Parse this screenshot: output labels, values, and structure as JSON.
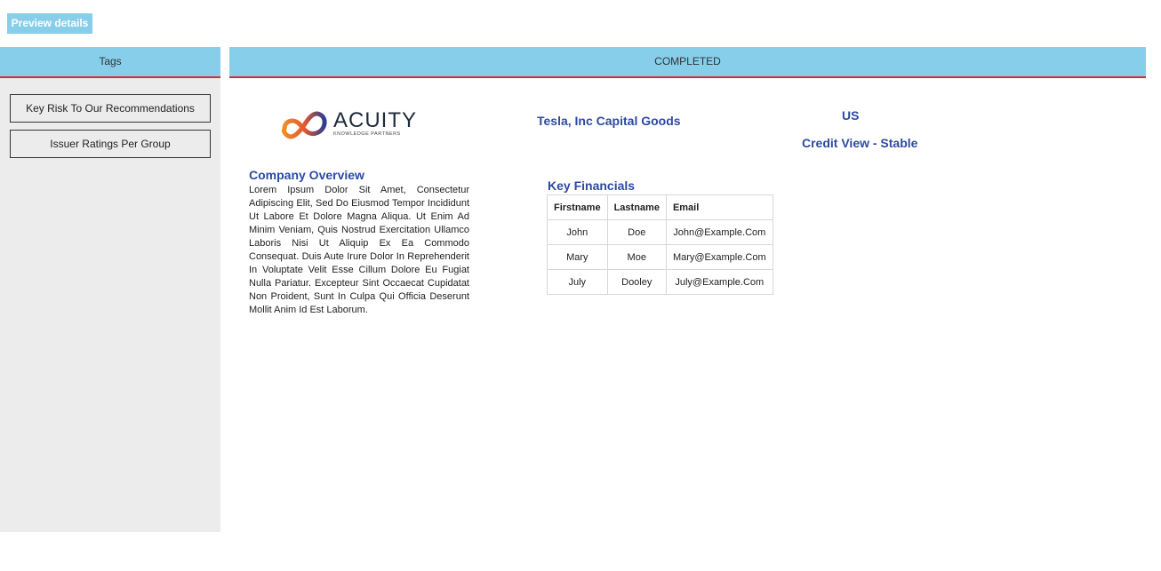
{
  "toolbar": {
    "preview_label": "Preview details"
  },
  "sidebar": {
    "header": "Tags",
    "items": [
      {
        "label": "Key Risk To Our Recommendations"
      },
      {
        "label": "Issuer Ratings Per Group"
      }
    ]
  },
  "main": {
    "status": "COMPLETED",
    "logo": {
      "name": "ACUITY",
      "tagline": "KNOWLEDGE PARTNERS"
    },
    "company_name": "Tesla, Inc Capital Goods",
    "country": "US",
    "credit_view": "Credit View - Stable",
    "overview": {
      "title": "Company Overview",
      "text": "Lorem Ipsum Dolor Sit Amet, Consectetur Adipiscing Elit, Sed Do Eiusmod Tempor Incididunt Ut Labore Et Dolore Magna Aliqua. Ut Enim Ad Minim Veniam, Quis Nostrud Exercitation Ullamco Laboris Nisi Ut Aliquip Ex Ea Commodo Consequat. Duis Aute Irure Dolor In Reprehenderit In Voluptate Velit Esse Cillum Dolore Eu Fugiat Nulla Pariatur. Excepteur Sint Occaecat Cupidatat Non Proident, Sunt In Culpa Qui Officia Deserunt Mollit Anim Id Est Laborum."
    },
    "financials": {
      "title": "Key Financials",
      "columns": [
        "Firstname",
        "Lastname",
        "Email"
      ],
      "rows": [
        [
          "John",
          "Doe",
          "John@Example.Com"
        ],
        [
          "Mary",
          "Moe",
          "Mary@Example.Com"
        ],
        [
          "July",
          "Dooley",
          "July@Example.Com"
        ]
      ]
    }
  },
  "colors": {
    "header_bg": "#87ceeb",
    "header_border": "#d32f2f",
    "title_blue": "#2d4aa3",
    "sidebar_bg": "#ececec"
  }
}
